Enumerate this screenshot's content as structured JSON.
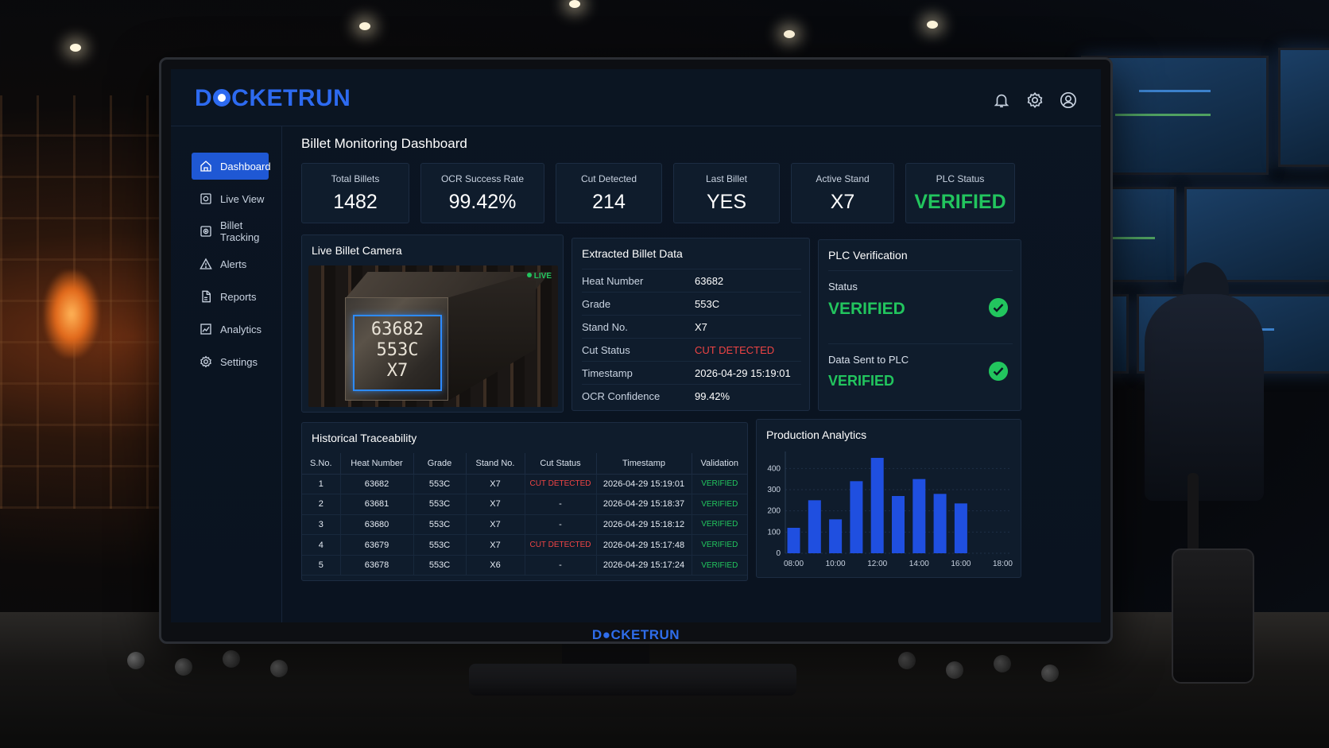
{
  "brand": {
    "name_pre": "D",
    "name_post": "CKETRUN"
  },
  "page_title": "Billet Monitoring Dashboard",
  "nav": [
    {
      "label": "Dashboard",
      "icon": "home-icon",
      "active": true
    },
    {
      "label": "Live View",
      "icon": "camera-icon",
      "active": false
    },
    {
      "label": "Billet Tracking",
      "icon": "target-icon",
      "active": false
    },
    {
      "label": "Alerts",
      "icon": "warning-icon",
      "active": false
    },
    {
      "label": "Reports",
      "icon": "document-icon",
      "active": false
    },
    {
      "label": "Analytics",
      "icon": "chart-icon",
      "active": false
    },
    {
      "label": "Settings",
      "icon": "gear-icon",
      "active": false
    }
  ],
  "topbar_icons": [
    "bell-icon",
    "gear-icon",
    "user-icon"
  ],
  "kpis": [
    {
      "label": "Total Billets",
      "value": "1482"
    },
    {
      "label": "OCR Success Rate",
      "value": "99.42%"
    },
    {
      "label": "Cut Detected",
      "value": "214"
    },
    {
      "label": "Last Billet",
      "value": "YES"
    },
    {
      "label": "Active Stand",
      "value": "X7"
    },
    {
      "label": "PLC Status",
      "value": "VERIFIED"
    }
  ],
  "camera": {
    "title": "Live Billet Camera",
    "live_label": "LIVE",
    "ocr_lines": [
      "63682",
      "553C",
      "X7"
    ]
  },
  "extracted": {
    "title": "Extracted Billet Data",
    "rows": [
      {
        "key": "Heat Number",
        "value": "63682"
      },
      {
        "key": "Grade",
        "value": "553C"
      },
      {
        "key": "Stand No.",
        "value": "X7"
      },
      {
        "key": "Cut Status",
        "value": "CUT DETECTED"
      },
      {
        "key": "Timestamp",
        "value": "2026-04-29 15:19:01"
      },
      {
        "key": "OCR Confidence",
        "value": "99.42%"
      }
    ]
  },
  "plc": {
    "title": "PLC Verification",
    "status_label": "Status",
    "status_value": "VERIFIED",
    "sent_label": "Data Sent to PLC",
    "sent_value": "VERIFIED"
  },
  "history": {
    "title": "Historical Traceability",
    "columns": [
      "S.No.",
      "Heat Number",
      "Grade",
      "Stand No.",
      "Cut Status",
      "Timestamp",
      "Validation"
    ],
    "rows": [
      [
        "1",
        "63682",
        "553C",
        "X7",
        "CUT DETECTED",
        "2026-04-29 15:19:01",
        "VERIFIED"
      ],
      [
        "2",
        "63681",
        "553C",
        "X7",
        "-",
        "2026-04-29 15:18:37",
        "VERIFIED"
      ],
      [
        "3",
        "63680",
        "553C",
        "X7",
        "-",
        "2026-04-29 15:18:12",
        "VERIFIED"
      ],
      [
        "4",
        "63679",
        "553C",
        "X7",
        "CUT DETECTED",
        "2026-04-29 15:17:48",
        "VERIFIED"
      ],
      [
        "5",
        "63678",
        "553C",
        "X6",
        "-",
        "2026-04-29 15:17:24",
        "VERIFIED"
      ]
    ]
  },
  "analytics": {
    "title": "Production Analytics",
    "chart_data": {
      "type": "bar",
      "x": [
        8,
        9,
        10,
        11,
        12,
        13,
        14,
        15,
        16,
        17,
        18
      ],
      "values": [
        120,
        250,
        160,
        340,
        450,
        270,
        350,
        280,
        235
      ],
      "bar_positions": [
        8,
        9,
        10,
        11,
        12,
        13,
        14,
        15,
        16
      ],
      "xticks": [
        "08:00",
        "10:00",
        "12:00",
        "14:00",
        "16:00",
        "18:00"
      ],
      "yticks": [
        0,
        100,
        200,
        300,
        400
      ],
      "ylim": [
        0,
        480
      ],
      "color": "#1f4fe0"
    }
  },
  "bezel_logo": {
    "pre": "D",
    "post": "CKETRUN"
  },
  "colors": {
    "accent": "#1f58d4",
    "ok": "#22c55e",
    "alert": "#ef4444"
  }
}
